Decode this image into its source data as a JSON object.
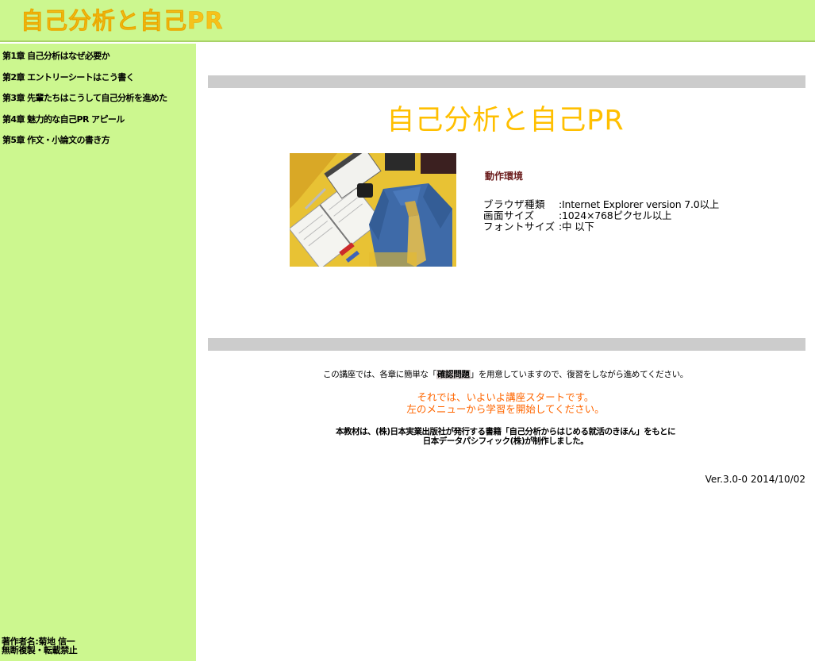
{
  "header": {
    "title": "自己分析と自己PR"
  },
  "sidebar": {
    "items": [
      {
        "label": "第1章 自己分析はなぜ必要か"
      },
      {
        "label": "第2章 エントリーシートはこう書く"
      },
      {
        "label": "第3章 先輩たちはこうして自己分析を進めた"
      },
      {
        "label": "第4章 魅力的な自己PR アピール"
      },
      {
        "label": "第5章 作文・小論文の書き方"
      }
    ],
    "footer": {
      "author": "著作者名:菊地 信一",
      "copyright": "無断複製・転載禁止"
    }
  },
  "main": {
    "title": "自己分析と自己PR",
    "hero_image_icon": "shirt-and-planner-image",
    "environment": {
      "heading": "動作環境",
      "rows": [
        {
          "label": "ブラウザ種類",
          "value": ":Internet Explorer version 7.0以上"
        },
        {
          "label": "画面サイズ",
          "value": ":1024×768ピクセル以上"
        },
        {
          "label": "フォントサイズ",
          "value": ":中 以下"
        }
      ]
    },
    "intro": {
      "prefix": "この講座では、各章に簡単な「",
      "highlight": "確認問題",
      "suffix": "」を用意していますので、復習をしながら進めてください。"
    },
    "start_message": {
      "line1": "それでは、いよいよ講座スタートです。",
      "line2": "左のメニューから学習を開始してください。"
    },
    "credit": {
      "line1": "本教材は、(株)日本実業出版社が発行する書籍「自己分析からはじめる就活のきほん」をもとに",
      "line2": "日本データパシフィック(株)が制作しました。"
    },
    "version": "Ver.3.0-0 2014/10/02"
  },
  "colors": {
    "sidebar_bg": "#ccf78f",
    "title": "#ffbf00",
    "start_message": "#ff6600",
    "divider": "#cccccc",
    "env_heading": "#6b1c1c"
  }
}
